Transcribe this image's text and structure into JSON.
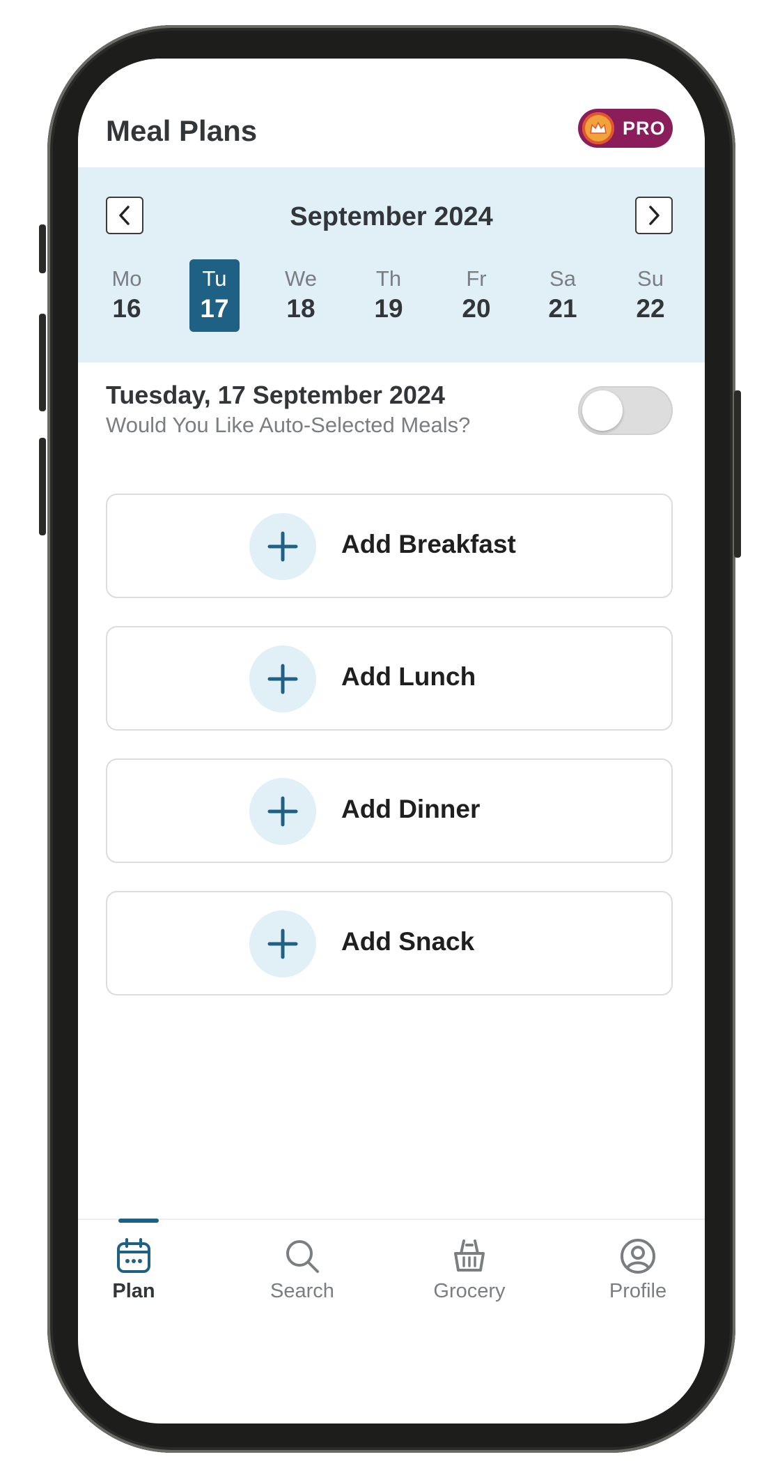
{
  "header": {
    "title": "Meal Plans",
    "pro_label": "PRO"
  },
  "calendar": {
    "month": "September 2024",
    "days": [
      {
        "abbr": "Mo",
        "num": "16",
        "selected": false
      },
      {
        "abbr": "Tu",
        "num": "17",
        "selected": true
      },
      {
        "abbr": "We",
        "num": "18",
        "selected": false
      },
      {
        "abbr": "Th",
        "num": "19",
        "selected": false
      },
      {
        "abbr": "Fr",
        "num": "20",
        "selected": false
      },
      {
        "abbr": "Sa",
        "num": "21",
        "selected": false
      },
      {
        "abbr": "Su",
        "num": "22",
        "selected": false
      }
    ]
  },
  "selected_date": {
    "title": "Tuesday, 17 September 2024",
    "auto_question": "Would You Like Auto-Selected Meals?",
    "auto_enabled": false
  },
  "meals": [
    {
      "label": "Add Breakfast"
    },
    {
      "label": "Add Lunch"
    },
    {
      "label": "Add Dinner"
    },
    {
      "label": "Add Snack"
    }
  ],
  "bottom_nav": [
    {
      "label": "Plan",
      "icon": "calendar-icon",
      "active": true
    },
    {
      "label": "Search",
      "icon": "search-icon",
      "active": false
    },
    {
      "label": "Grocery",
      "icon": "basket-icon",
      "active": false
    },
    {
      "label": "Profile",
      "icon": "profile-icon",
      "active": false
    }
  ],
  "colors": {
    "primary": "#1f6185",
    "calendar_bg": "#e1eff7",
    "pro_badge": "#8c1d5b",
    "text_dark": "#333639",
    "text_muted": "#7b7e80"
  }
}
